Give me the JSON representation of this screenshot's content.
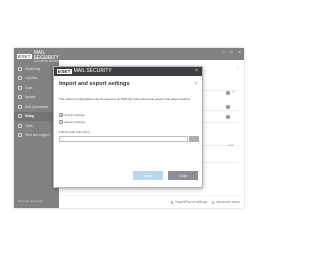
{
  "app": {
    "logo_mark": "ESET",
    "logo_text": "MAIL SECURITY",
    "logo_sub": "FOR MICROSOFT EXCHANGE SERVER",
    "win_controls": [
      "–",
      "□",
      "×"
    ],
    "nav": [
      {
        "label": "Monitoring",
        "icon": "monitor-icon"
      },
      {
        "label": "Log files",
        "icon": "log-icon"
      },
      {
        "label": "Scan",
        "icon": "scan-icon"
      },
      {
        "label": "Update",
        "icon": "update-icon"
      },
      {
        "label": "Mail Quarantine",
        "icon": "quarantine-icon"
      },
      {
        "label": "Setup",
        "icon": "setup-icon",
        "active": true
      },
      {
        "label": "Tools",
        "icon": "tools-icon"
      },
      {
        "label": "Help and support",
        "icon": "help-icon"
      }
    ],
    "progress_label": "Progress. Protected.",
    "main": {
      "help": "?",
      "proxy_text": "ssion"
    },
    "bottombar": {
      "import_export": "Import/Export settings",
      "advanced_setup": "Advanced setup"
    }
  },
  "dialog": {
    "logo_mark": "ESET",
    "logo_text": "MAIL SECURITY",
    "close": "×",
    "heading": "Import and export settings",
    "help": "?",
    "description": "The current configuration can be saved to an XML file and restored at a later time when needed.",
    "options": [
      {
        "label": "Import settings",
        "selected": true
      },
      {
        "label": "Export settings",
        "selected": false
      }
    ],
    "path_label": "Full file path with name:",
    "path_value": "",
    "browse_label": "...",
    "primary_button": "Import",
    "secondary_button": "Close"
  }
}
